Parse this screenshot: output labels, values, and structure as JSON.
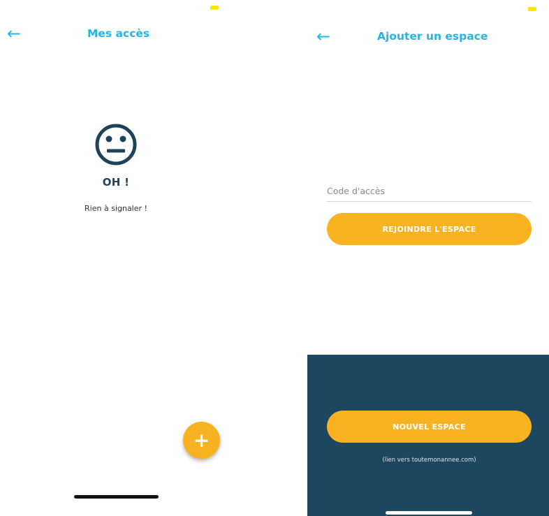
{
  "left_screen": {
    "back_icon": "arrow-left-icon",
    "title": "Mes accès",
    "empty_icon": "neutral-face-icon",
    "empty_title": "OH !",
    "empty_message": "Rien à signaler !",
    "fab_icon": "plus-icon",
    "fab_symbol": "+"
  },
  "right_screen": {
    "back_icon": "arrow-left-icon",
    "title": "Ajouter un espace",
    "code_input": {
      "placeholder": "Code d'accès",
      "value": ""
    },
    "join_button_label": "REJOINDRE L'ESPACE",
    "new_space_button_label": "NOUVEL ESPACE",
    "link_note": "(lien vers toutemonannee.com)"
  },
  "colors": {
    "accent_blue": "#27b3e6",
    "accent_orange": "#f9b222",
    "dark_navy": "#1d4761",
    "icon_navy": "#1f4259",
    "status_yellow": "#ffe500"
  }
}
